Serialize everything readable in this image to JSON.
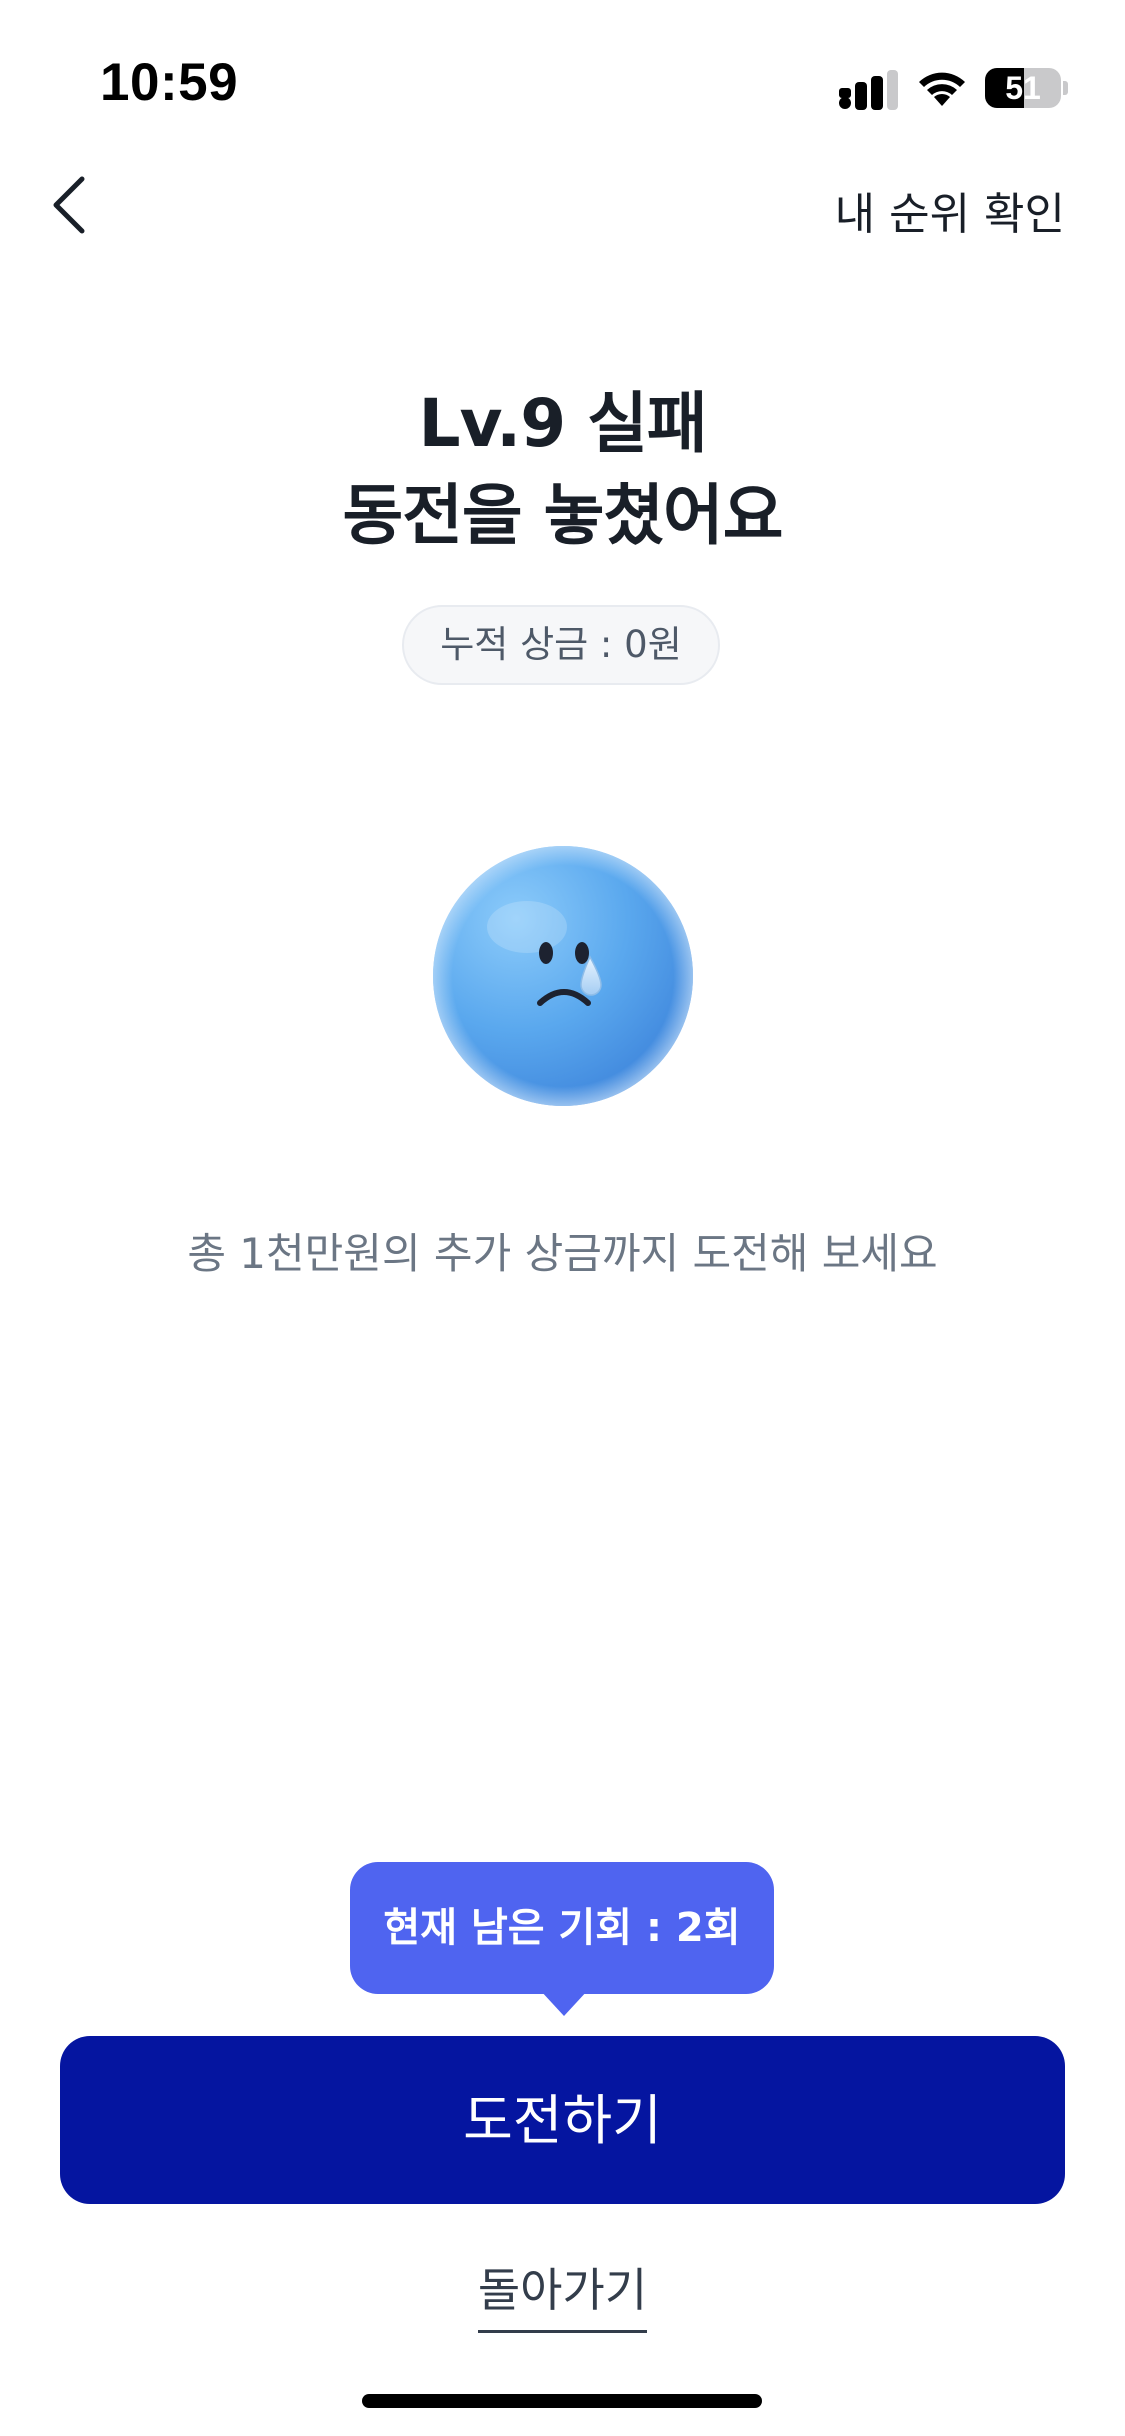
{
  "status_bar": {
    "time": "10:59",
    "battery_level": "51",
    "battery_fraction": 0.51,
    "icons": [
      "cellular-signal-icon",
      "wifi-icon",
      "battery-icon"
    ]
  },
  "nav": {
    "back_icon": "chevron-left-icon",
    "action_label": "내 순위 확인"
  },
  "result": {
    "title_line1": "Lv.9 실패",
    "title_line2": "동전을 놓쳤어요",
    "prize_chip": "누적 상금 : 0원",
    "illustration": "sad-face-icon",
    "subtext": "총 1천만원의 추가 상금까지 도전해 보세요"
  },
  "cta": {
    "tooltip": "현재 남은 기회 : 2회",
    "primary_label": "도전하기",
    "secondary_label": "돌아가기"
  },
  "colors": {
    "primary": "#0515a0",
    "tooltip": "#4f64f0",
    "title": "#191f28",
    "subtext": "#6b7684",
    "face": "#5aa8ee"
  }
}
